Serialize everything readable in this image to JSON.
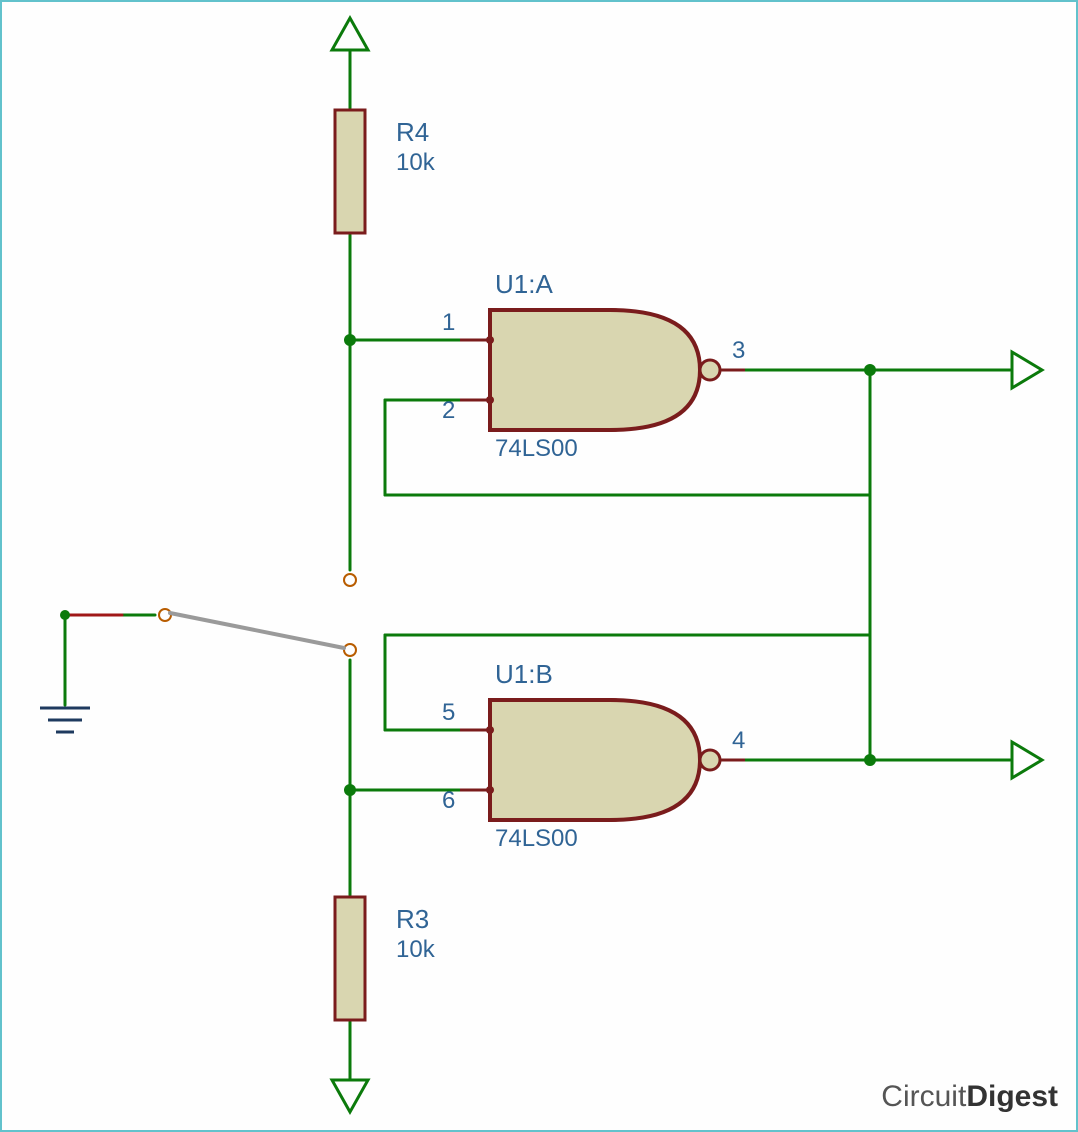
{
  "gates": {
    "a": {
      "ref": "U1:A",
      "part": "74LS00",
      "pins": {
        "in1": "1",
        "in2": "2",
        "out": "3"
      }
    },
    "b": {
      "ref": "U1:B",
      "part": "74LS00",
      "pins": {
        "in1": "5",
        "in2": "6",
        "out": "4"
      }
    }
  },
  "resistors": {
    "r4": {
      "ref": "R4",
      "value": "10k"
    },
    "r3": {
      "ref": "R3",
      "value": "10k"
    }
  },
  "brand": {
    "left": "Circuit",
    "right": "Digest"
  }
}
